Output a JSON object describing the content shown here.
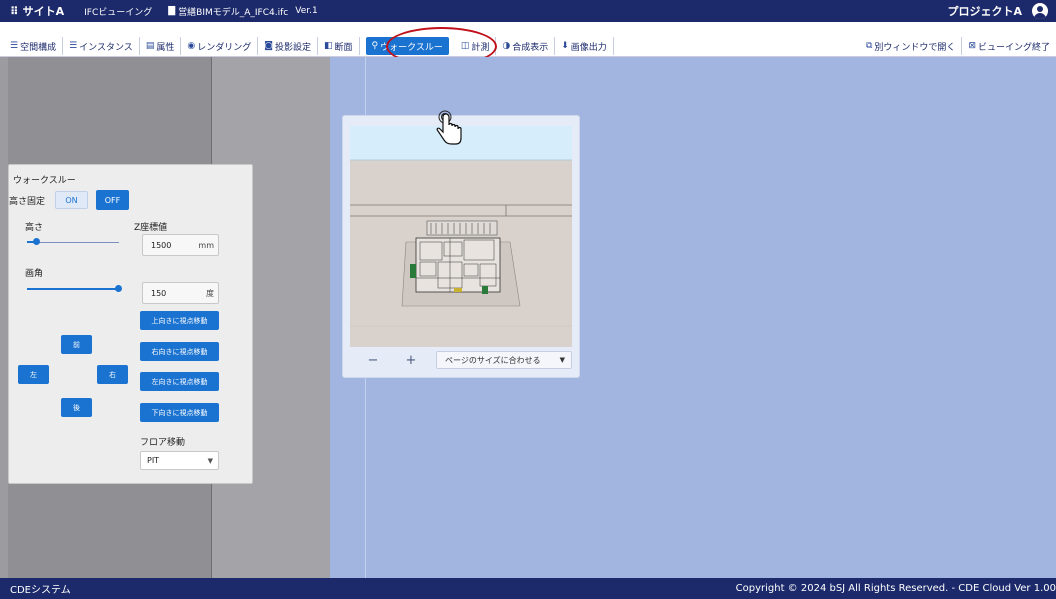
{
  "header": {
    "site": "サイトA",
    "mode": "IFCビューイング",
    "file": "営繕BIMモデル_A_IFC4.ifc",
    "version": "Ver.1",
    "project": "プロジェクトA"
  },
  "toolbar": {
    "items": [
      {
        "label": "空間構成",
        "icon": "list-icon"
      },
      {
        "label": "インスタンス",
        "icon": "list-icon"
      },
      {
        "label": "属性",
        "icon": "table-icon"
      },
      {
        "label": "レンダリング",
        "icon": "palette-icon"
      },
      {
        "label": "投影設定",
        "icon": "camera-icon"
      },
      {
        "label": "断面",
        "icon": "section-icon"
      },
      {
        "label": "ウォークスルー",
        "icon": "walk-icon",
        "active": true
      },
      {
        "label": "計測",
        "icon": "ruler-icon"
      },
      {
        "label": "合成表示",
        "icon": "composite-icon"
      },
      {
        "label": "画像出力",
        "icon": "download-icon"
      }
    ],
    "open_new_window": "別ウィンドウで開く",
    "end_viewing": "ビューイング終了"
  },
  "walkthrough": {
    "title": "ウォークスルー",
    "height_fixed_label": "高さ固定",
    "on_label": "ON",
    "off_label": "OFF",
    "height_label": "高さ",
    "z_label": "Z座標値",
    "z_value": "1500",
    "z_unit": "mm",
    "angle_label": "画角",
    "angle_value": "150",
    "angle_unit": "度",
    "height_slider_level": 0.1,
    "angle_slider_level": 1.0,
    "forward": "前",
    "left": "左",
    "right": "右",
    "back": "後",
    "view_up": "上向きに視点移動",
    "view_right": "右向きに視点移動",
    "view_left": "左向きに視点移動",
    "view_down": "下向きに視点移動",
    "floor_label": "フロア移動",
    "floor_value": "PIT"
  },
  "navigator": {
    "minus": "−",
    "plus": "+",
    "fit_option": "ページのサイズに合わせる"
  },
  "footer": {
    "system": "CDEシステム",
    "copyright": "Copyright © 2024 bSJ All Rights Reserved. - CDE Cloud Ver 1.00"
  },
  "colors": {
    "header": "#1c2a6b",
    "accent": "#1b73d1",
    "viewport": "#a2b5e0",
    "highlight": "#c0101a"
  }
}
